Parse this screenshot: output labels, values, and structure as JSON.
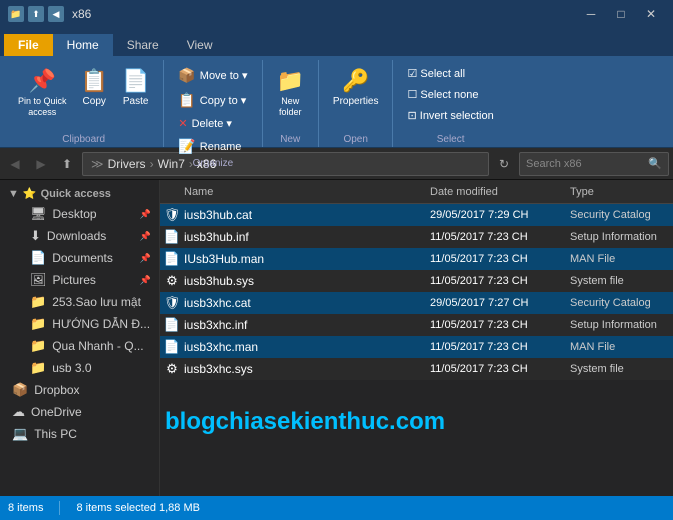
{
  "titleBar": {
    "title": "x86",
    "icons": [
      "📁",
      "⬆",
      "🔙"
    ],
    "windowControls": [
      "─",
      "□",
      "✕"
    ]
  },
  "ribbonTabs": [
    {
      "label": "File",
      "active": false
    },
    {
      "label": "Home",
      "active": true
    },
    {
      "label": "Share",
      "active": false
    },
    {
      "label": "View",
      "active": false
    }
  ],
  "ribbon": {
    "groups": [
      {
        "label": "Clipboard",
        "buttons": [
          {
            "label": "Pin to Quick\naccess",
            "icon": "📌",
            "small": false
          },
          {
            "label": "Copy",
            "icon": "📋",
            "small": false
          },
          {
            "label": "Paste",
            "icon": "📄",
            "small": false
          }
        ]
      },
      {
        "label": "Organize",
        "smallButtons": [
          {
            "label": "Move to ▾",
            "icon": "📦"
          },
          {
            "label": "Copy to ▾",
            "icon": "📋"
          },
          {
            "label": "Delete ▾",
            "icon": "🗑"
          },
          {
            "label": "Rename",
            "icon": "✏"
          }
        ]
      },
      {
        "label": "New",
        "buttons": [
          {
            "label": "New\nfolder",
            "icon": "📁",
            "small": false
          }
        ]
      },
      {
        "label": "Open",
        "buttons": [
          {
            "label": "Properties",
            "icon": "🔍",
            "small": false
          }
        ]
      },
      {
        "label": "Select",
        "selectButtons": [
          {
            "label": "Select all"
          },
          {
            "label": "Select none"
          },
          {
            "label": "Invert selection"
          }
        ]
      }
    ]
  },
  "addressBar": {
    "pathParts": [
      "Drivers",
      "Win7",
      "x86"
    ],
    "searchPlaceholder": "Search x86"
  },
  "sidebar": {
    "items": [
      {
        "label": "Quick access",
        "icon": "⭐",
        "type": "header",
        "indent": 0
      },
      {
        "label": "Desktop",
        "icon": "🖥",
        "indent": 1,
        "pinned": true
      },
      {
        "label": "Downloads",
        "icon": "⬇",
        "indent": 1,
        "pinned": true
      },
      {
        "label": "Documents",
        "icon": "📄",
        "indent": 1,
        "pinned": true
      },
      {
        "label": "Pictures",
        "icon": "🖼",
        "indent": 1,
        "pinned": true
      },
      {
        "label": "253.Sao lưu mật",
        "icon": "📁",
        "indent": 1
      },
      {
        "label": "HƯỚNG DẪN Đ...",
        "icon": "📁",
        "indent": 1
      },
      {
        "label": "Qua Nhanh - Q...",
        "icon": "📁",
        "indent": 1
      },
      {
        "label": "usb 3.0",
        "icon": "📁",
        "indent": 1
      },
      {
        "label": "Dropbox",
        "icon": "📦",
        "indent": 0
      },
      {
        "label": "OneDrive",
        "icon": "☁",
        "indent": 0
      },
      {
        "label": "This PC",
        "icon": "💻",
        "indent": 0
      }
    ]
  },
  "columnHeaders": [
    {
      "label": "Name",
      "key": "name"
    },
    {
      "label": "Date modified",
      "key": "date"
    },
    {
      "label": "Type",
      "key": "type"
    }
  ],
  "files": [
    {
      "name": "iusb3hub.cat",
      "icon": "🛡",
      "date": "29/05/2017 7:29 CH",
      "type": "Security Catalog",
      "selected": false
    },
    {
      "name": "iusb3hub.inf",
      "icon": "📄",
      "date": "11/05/2017 7:23 CH",
      "type": "Setup Information",
      "selected": false
    },
    {
      "name": "IUsb3Hub.man",
      "icon": "📄",
      "date": "11/05/2017 7:23 CH",
      "type": "MAN File",
      "selected": false
    },
    {
      "name": "iusb3hub.sys",
      "icon": "⚙",
      "date": "11/05/2017 7:23 CH",
      "type": "System file",
      "selected": false
    },
    {
      "name": "iusb3xhc.cat",
      "icon": "🛡",
      "date": "29/05/2017 7:27 CH",
      "type": "Security Catalog",
      "selected": false
    },
    {
      "name": "iusb3xhc.inf",
      "icon": "📄",
      "date": "11/05/2017 7:23 CH",
      "type": "Setup Information",
      "selected": false
    },
    {
      "name": "iusb3xhc.man",
      "icon": "📄",
      "date": "11/05/2017 7:23 CH",
      "type": "MAN File",
      "selected": false
    },
    {
      "name": "iusb3xhc.sys",
      "icon": "⚙",
      "date": "11/05/2017 7:23 CH",
      "type": "System file",
      "selected": false
    }
  ],
  "statusBar": {
    "itemCount": "8 items",
    "selectedInfo": "8 items selected  1,88 MB"
  },
  "watermark": "blogchiasekienthuc.com"
}
